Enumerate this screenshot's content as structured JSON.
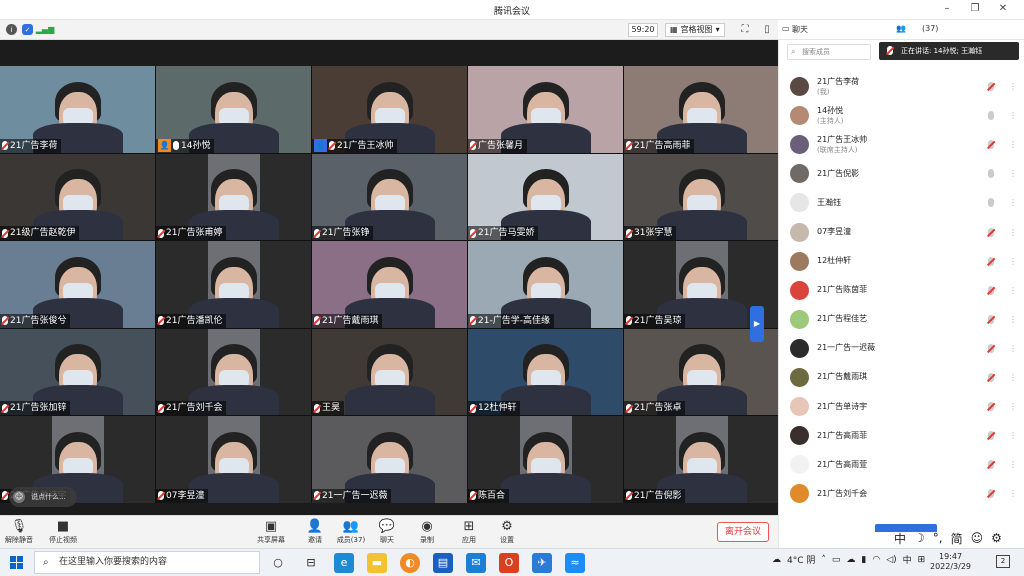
{
  "window": {
    "title": "腾讯会议"
  },
  "toolbar": {
    "timer": "59:20",
    "view_label": "宫格视图",
    "view_chevron": "▾"
  },
  "panel": {
    "chat_tab": "聊天",
    "members_tab": "(37)",
    "search_placeholder": "搜索成员",
    "speaking": "正在讲话: 14孙悦; 王瀚钰",
    "participants": [
      {
        "name": "21广告李荷",
        "sub": "(我)",
        "muted": true,
        "avatar_color": "#5b4a44"
      },
      {
        "name": "14孙悦",
        "sub": "(主持人)",
        "muted": false,
        "avatar_color": "#b58a74"
      },
      {
        "name": "21广告王冰帅",
        "sub": "(联席主持人)",
        "muted": true,
        "avatar_color": "#6a5e7a"
      },
      {
        "name": "21广告倪影",
        "sub": "",
        "muted": false,
        "avatar_color": "#6f6a66"
      },
      {
        "name": "王瀚钰",
        "sub": "",
        "muted": false,
        "avatar_color": "#e6e6e6"
      },
      {
        "name": "07李昱潼",
        "sub": "",
        "muted": true,
        "avatar_color": "#c7b8ac"
      },
      {
        "name": "12杜仲轩",
        "sub": "",
        "muted": true,
        "avatar_color": "#9b7a5e"
      },
      {
        "name": "21广告陈茵菲",
        "sub": "",
        "muted": true,
        "avatar_color": "#d9453b"
      },
      {
        "name": "21广告程佳艺",
        "sub": "",
        "muted": true,
        "avatar_color": "#9cc97a"
      },
      {
        "name": "21一广告一迟薇",
        "sub": "",
        "muted": true,
        "avatar_color": "#2b2b2b"
      },
      {
        "name": "21广告戴雨琪",
        "sub": "",
        "muted": true,
        "avatar_color": "#6e6a40"
      },
      {
        "name": "21广告单诗宇",
        "sub": "",
        "muted": true,
        "avatar_color": "#e7c6b8"
      },
      {
        "name": "21广告高雨菲",
        "sub": "",
        "muted": true,
        "avatar_color": "#3a2f2c"
      },
      {
        "name": "21广告高雨萱",
        "sub": "",
        "muted": true,
        "avatar_color": "#f2f2f2"
      },
      {
        "name": "21广告刘千会",
        "sub": "",
        "muted": true,
        "avatar_color": "#e08a2a"
      }
    ]
  },
  "tiles": [
    {
      "name": "21广告李荷",
      "bg": "#6e8ea0",
      "badge": ""
    },
    {
      "name": "14孙悦",
      "bg": "#5d6a6a",
      "badge": "host"
    },
    {
      "name": "21广告王冰帅",
      "bg": "#4a3d36",
      "badge": "cohost"
    },
    {
      "name": "广告张馨月",
      "bg": "#b9a3a6",
      "badge": ""
    },
    {
      "name": "21广告高雨菲",
      "bg": "#8d7b76",
      "badge": ""
    },
    {
      "name": "21级广告赵乾伊",
      "bg": "#3b3734",
      "badge": ""
    },
    {
      "name": "21广告张甫婷",
      "bg": "dark",
      "badge": ""
    },
    {
      "name": "21广告张铮",
      "bg": "#5b6168",
      "badge": ""
    },
    {
      "name": "21广告马雯娇",
      "bg": "#c2c8cf",
      "badge": ""
    },
    {
      "name": "31张宇慧",
      "bg": "#4f4c4a",
      "badge": ""
    },
    {
      "name": "21广告张俊兮",
      "bg": "#6a7e93",
      "badge": ""
    },
    {
      "name": "21广告潘凯伦",
      "bg": "dark",
      "badge": ""
    },
    {
      "name": "21广告戴雨琪",
      "bg": "#8b6f86",
      "badge": ""
    },
    {
      "name": "21-广告学-高佳缘",
      "bg": "#9aa9b3",
      "badge": ""
    },
    {
      "name": "21广告吴琼",
      "bg": "dark",
      "badge": ""
    },
    {
      "name": "21广告张加锌",
      "bg": "#45505a",
      "badge": ""
    },
    {
      "name": "21广告刘千会",
      "bg": "dark",
      "badge": ""
    },
    {
      "name": "王昊",
      "bg": "#3f3a36",
      "badge": ""
    },
    {
      "name": "12杜仲轩",
      "bg": "#2e4c6a",
      "badge": ""
    },
    {
      "name": "21广告张卓",
      "bg": "#5a5450",
      "badge": ""
    },
    {
      "name": "21广告单诗宇",
      "bg": "dark",
      "badge": ""
    },
    {
      "name": "07李昱潼",
      "bg": "dark",
      "badge": ""
    },
    {
      "name": "21一广告一迟薇",
      "bg": "#5b5b5e",
      "badge": ""
    },
    {
      "name": "陈百合",
      "bg": "dark",
      "badge": ""
    },
    {
      "name": "21广告倪影",
      "bg": "dark",
      "badge": ""
    }
  ],
  "chat_bubble": "说点什么...",
  "bottom": {
    "unmute": "解除静音",
    "stop_video": "停止视频",
    "share": "共享屏幕",
    "invite": "邀请",
    "members": "成员(37)",
    "chat": "聊天",
    "record": "录制",
    "apps": "应用",
    "settings": "设置",
    "leave": "离开会议"
  },
  "ime": {
    "lang": "中",
    "moon": "☽",
    "punct": "°,",
    "mode": "简",
    "emoji": "☺",
    "gear": "⚙"
  },
  "taskbar": {
    "search_placeholder": "在这里输入你要搜索的内容",
    "weather": "4°C 阴",
    "tray_lang": "中",
    "time": "19:47",
    "date": "2022/3/29"
  }
}
